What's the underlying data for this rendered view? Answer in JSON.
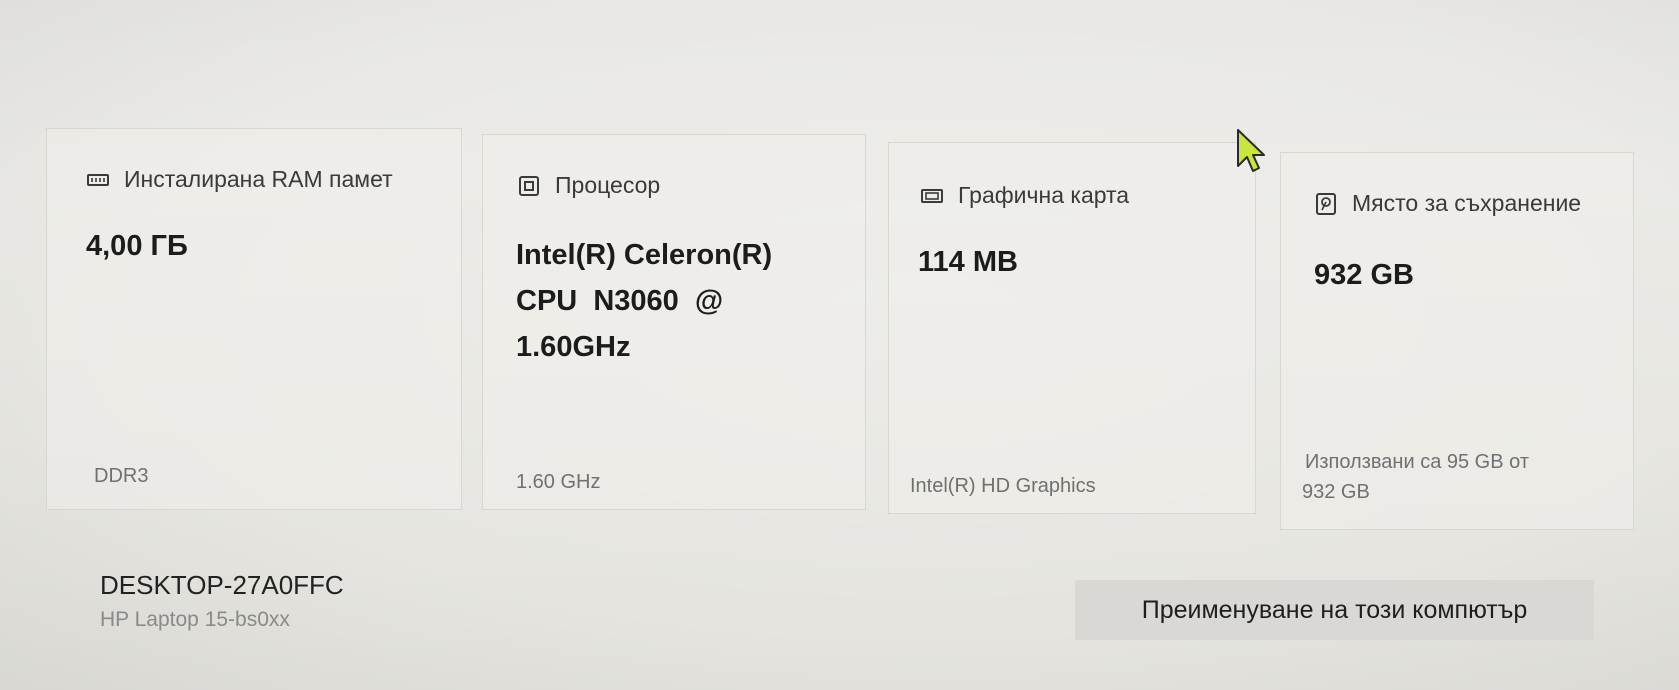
{
  "cards": [
    {
      "icon": "ram-icon",
      "title": "Инсталирана RAM памет",
      "value": "4,00 ГБ",
      "sub": "DDR3"
    },
    {
      "icon": "processor-icon",
      "title": "Процесор",
      "value_lines": [
        "Intel(R) Celeron(R)",
        "CPU  N3060  @",
        "1.60GHz"
      ],
      "sub": "1.60 GHz"
    },
    {
      "icon": "graphics-card-icon",
      "title": "Графична карта",
      "value": "114 MB",
      "sub": "Intel(R) HD Graphics"
    },
    {
      "icon": "storage-icon",
      "title": "Място за съхранение",
      "value": "932 GB",
      "sub_lines": [
        "Използвани са 95 GB от",
        "932 GB"
      ]
    }
  ],
  "device": {
    "name": "DESKTOP-27A0FFC",
    "model": "HP Laptop 15-bs0xx"
  },
  "rename_button": {
    "label": "Преименуване на този компютър"
  },
  "colors": {
    "accent_cursor": "#c8e63c",
    "background": "#e9e8e4",
    "button_bg": "#d9d8d4"
  }
}
